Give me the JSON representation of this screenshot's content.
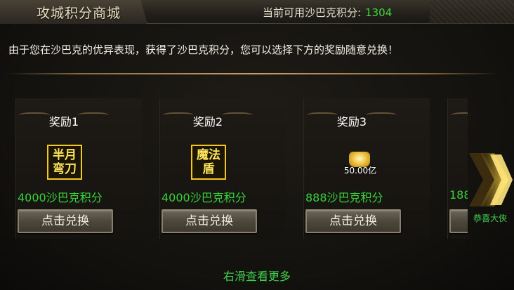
{
  "header": {
    "title": "攻城积分商城",
    "points_label": "当前可用沙巴克积分:",
    "points_value": "1304"
  },
  "description": "由于您在沙巴克的优异表现，获得了沙巴克积分，您可以选择下方的奖励随意兑换！",
  "rewards": [
    {
      "title": "奖励1",
      "icon": "banyue-wandao-skill-icon",
      "icon_text": "半月弯刀",
      "cost": "4000沙巴克积分",
      "button": "点击兑换"
    },
    {
      "title": "奖励2",
      "icon": "mofadun-skill-icon",
      "icon_text": "魔法盾",
      "cost": "4000沙巴克积分",
      "button": "点击兑换"
    },
    {
      "title": "奖励3",
      "icon": "gold-ingot-icon",
      "amount": "50.00亿",
      "cost": "888沙巴克积分",
      "button": "点击兑换"
    },
    {
      "cost": "188"
    }
  ],
  "congrats_text": "恭喜大侠",
  "scroll_hint": "右滑查看更多",
  "colors": {
    "accent_green": "#3fd04a",
    "gold": "#f2c81f"
  }
}
